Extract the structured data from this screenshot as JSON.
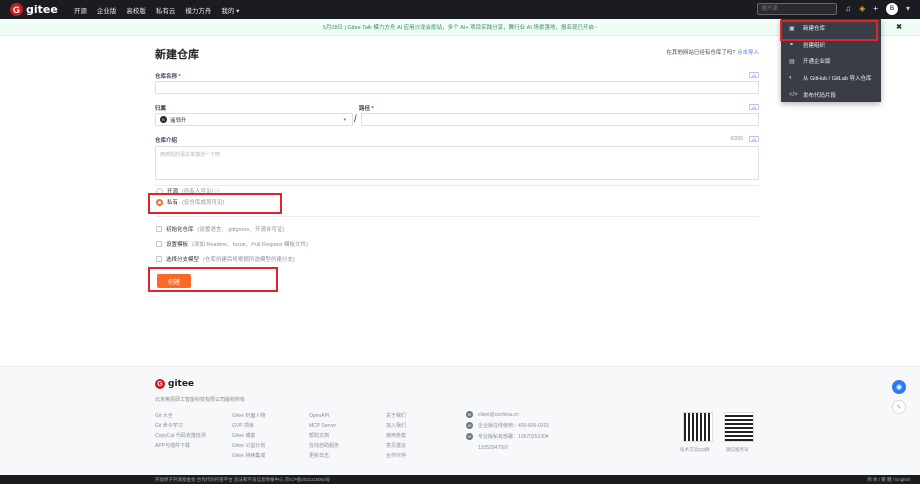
{
  "nav": {
    "logo_letter": "G",
    "logo_text": "gitee",
    "links": [
      "开源",
      "企业版",
      "高校版",
      "私有云",
      "模力方舟",
      "我的 ▾"
    ],
    "search_placeholder": "搜开源"
  },
  "banner": {
    "text": "5月28日 | Gitee Talk 模力方舟 AI 应用沙龙会即站，多个 AI+ 项目实践分享，舞行业 AI 场景落地，报名现已开启~",
    "close": "✖"
  },
  "dropdown": {
    "items": [
      {
        "icon": "▣",
        "label": "新建仓库"
      },
      {
        "icon": "⚭",
        "label": "创建组织"
      },
      {
        "icon": "▤",
        "label": "开通企业版"
      },
      {
        "icon": "◐",
        "label": "从 GitHub / GitLab 导入仓库"
      },
      {
        "icon": "</>",
        "label": "发布代码片段"
      }
    ]
  },
  "form": {
    "title": "新建仓库",
    "import_hint": "在其他网站已经有仓库了吗?",
    "import_link": "点击导入",
    "repo_name_label": "仓库名称",
    "required_mark": "*",
    "ai_badge": "AI",
    "owner_label": "归属",
    "owner_value": "遥领升",
    "owner_avatar": "B",
    "path_label": "路径",
    "slash": "/",
    "desc_label": "仓库介绍",
    "desc_counter": "0/200",
    "desc_placeholder": "用简短的语言来描述一下吧",
    "visibility": [
      {
        "label": "开源",
        "note": "(所有人可见) ⓘ",
        "selected": false
      },
      {
        "label": "私有",
        "note": "(仅仓库成员可见)",
        "selected": true
      }
    ],
    "options": [
      {
        "label": "初始化仓库",
        "note": "(设置语言、.gitignore、开源许可证)"
      },
      {
        "label": "设置模板",
        "note": "(添加 Readme、Issue、Pull Request 模板文件)"
      },
      {
        "label": "选择分支模型",
        "note": "(仓库创建后将根据所选模型创建分支)"
      }
    ],
    "create_button": "创建"
  },
  "footer": {
    "logo_letter": "G",
    "logo_text": "gitee",
    "copyright": "北京奥思研工智能科技有限公司版权所有",
    "col1": [
      "Git 大全",
      "Git 命令学习",
      "CopyCat 代码克隆检测",
      "APP与插件下载"
    ],
    "col2": [
      "Gitee 封面人物",
      "GVP 项目",
      "Gitee 博客",
      "Gitee 公益计划",
      "Gitee 持续集成"
    ],
    "col3": [
      "OpenAPI",
      "MCP Server",
      "帮助文档",
      "在线自助服务",
      "更新日志"
    ],
    "col4": [
      "关于我们",
      "加入我们",
      "使用条款",
      "意见建议",
      "合作伙伴"
    ],
    "contacts": [
      {
        "icon": "✉",
        "text": "client@oschina.cn"
      },
      {
        "icon": "☏",
        "text": "企业版在线使用：400-606-0201"
      },
      {
        "icon": "☏",
        "text": "专业版私有部署：13670252304"
      },
      {
        "icon": "",
        "text": "13352947997"
      }
    ],
    "qr1_caption": "技术交流QQ群",
    "qr2_caption": "微信服务号",
    "bottom_left": "开放原子开源基金会  合作代码托管平台    违法和不良信息举报中心    京ICP备2021118063号",
    "bottom_right": "简 体 / 繁 體 / English"
  },
  "colors": {
    "accent": "#f96a28",
    "highlight": "#e0242b",
    "nav_bg": "#1b1c21"
  }
}
